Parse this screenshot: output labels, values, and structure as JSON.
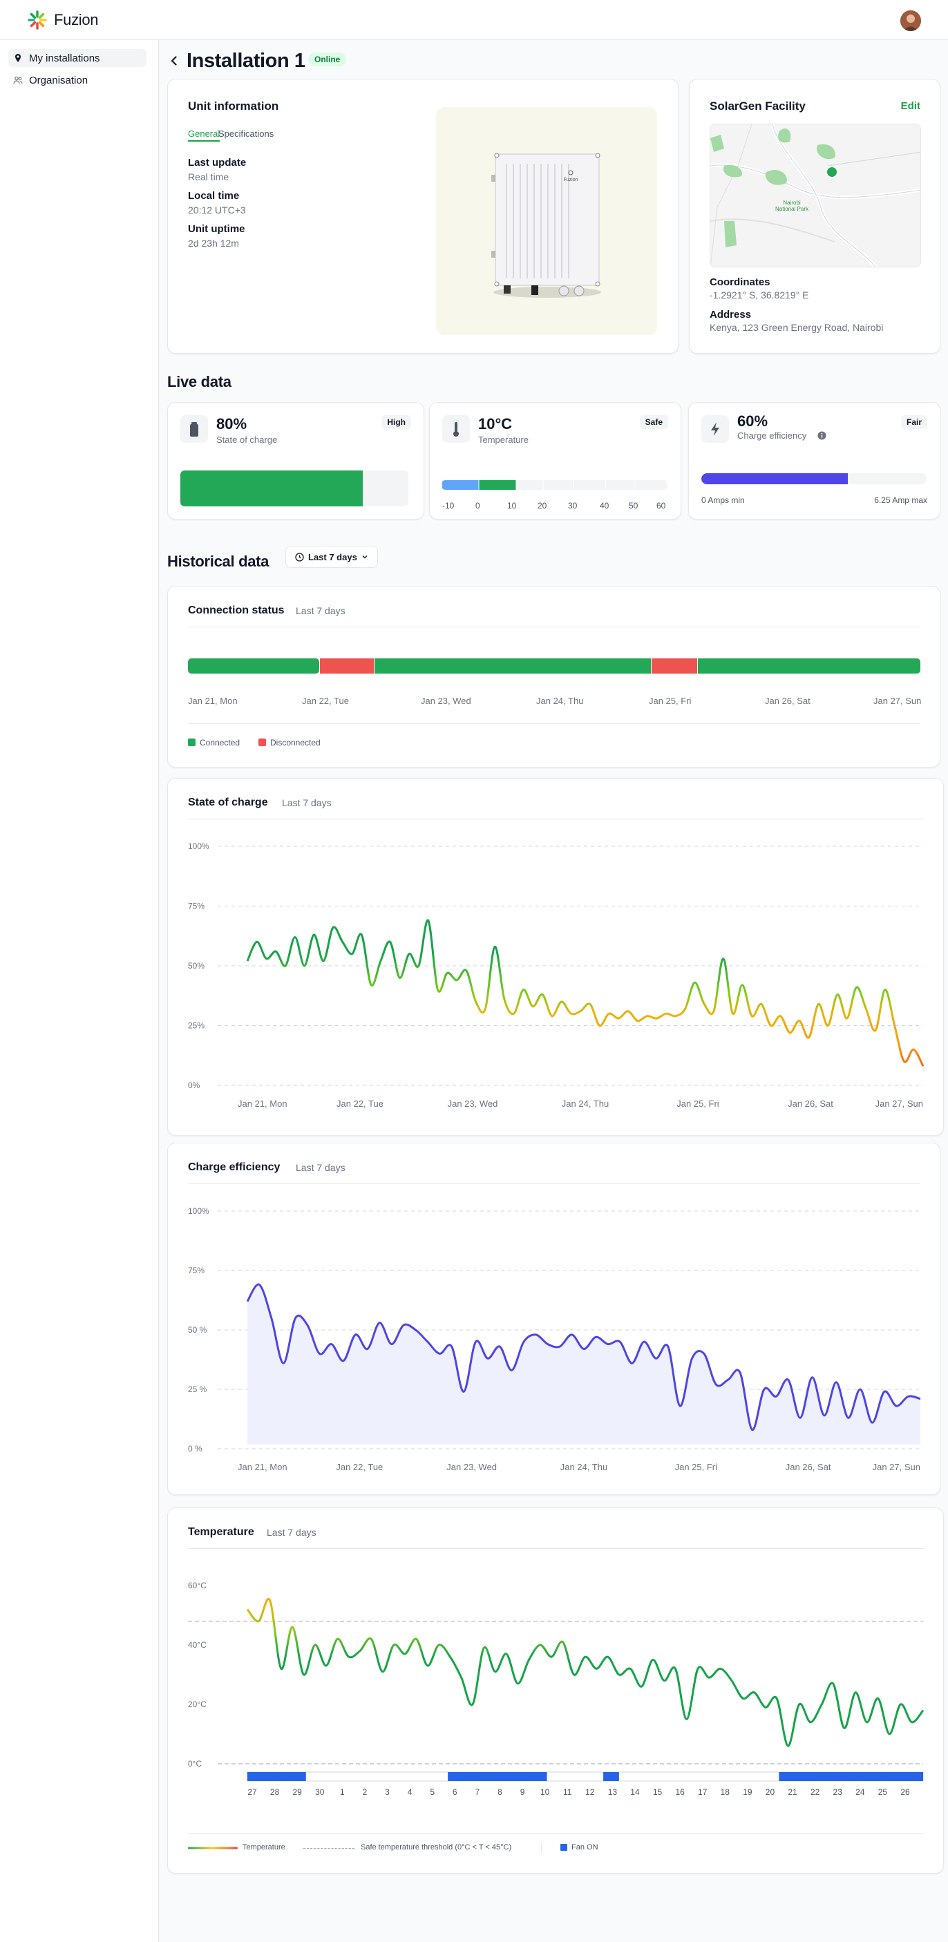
{
  "app": {
    "name": "Fuzion"
  },
  "sidebar": {
    "items": [
      {
        "label": "My installations"
      },
      {
        "label": "Organisation"
      }
    ]
  },
  "page": {
    "title": "Installation 1",
    "status": "Online"
  },
  "unit_info": {
    "title": "Unit information",
    "tabs": [
      {
        "label": "General"
      },
      {
        "label": "Specifications"
      }
    ],
    "fields": [
      {
        "label": "Last update",
        "value": "Real time"
      },
      {
        "label": "Local time",
        "value": "20:12 UTC+3"
      },
      {
        "label": "Unit uptime",
        "value": "2d 23h 12m"
      }
    ],
    "device_brand": "Fuzion"
  },
  "facility": {
    "title": "SolarGen Facility",
    "edit_label": "Edit",
    "map_label_line1": "Nairobi",
    "map_label_line2": "National Park",
    "coordinates_label": "Coordinates",
    "coordinates": "-1.2921° S, 36.8219° E",
    "address_label": "Address",
    "address": "Kenya, 123 Green Energy Road, Nairobi"
  },
  "live": {
    "title": "Live data",
    "soc": {
      "value": "80%",
      "label": "State of charge",
      "badge": "High",
      "fill": 0.8
    },
    "temp": {
      "value": "10°C",
      "label": "Temperature",
      "badge": "Safe",
      "ticks": [
        "-10",
        "0",
        "10",
        "20",
        "30",
        "40",
        "50",
        "60"
      ]
    },
    "eff": {
      "value": "60%",
      "label": "Charge efficiency",
      "badge": "Fair",
      "fill": 0.65,
      "min_label": "0 Amps min",
      "max_label": "6.25 Amp max"
    }
  },
  "historical": {
    "title": "Historical data",
    "range_label": "Last 7 days"
  },
  "connection": {
    "title": "Connection status",
    "subtitle": "Last 7 days",
    "days": [
      "Jan 21, Mon",
      "Jan 22, Tue",
      "Jan 23, Wed",
      "Jan 24, Thu",
      "Jan 25, Fri",
      "Jan 26, Sat",
      "Jan 27, Sun"
    ],
    "legend": [
      {
        "label": "Connected",
        "color": "#22a857"
      },
      {
        "label": "Disconnected",
        "color": "#ef5350"
      }
    ]
  },
  "colors": {
    "green": "#22a857",
    "red": "#ef5350",
    "purple": "#4f46e5",
    "blue": "#2563eb"
  },
  "chart_data": [
    {
      "type": "line",
      "title": "State of charge",
      "subtitle": "Last 7 days",
      "ylim": [
        0,
        100
      ],
      "yticks": [
        "100%",
        "75%",
        "50%",
        "25%",
        "0%"
      ],
      "categories": [
        "Jan 21, Mon",
        "Jan 22, Tue",
        "Jan 23, Wed",
        "Jan 24, Thu",
        "Jan 25, Fri",
        "Jan 26, Sat",
        "Jan 27, Sun"
      ],
      "values": [
        52,
        60,
        53,
        56,
        50,
        62,
        50,
        63,
        52,
        66,
        60,
        55,
        63,
        42,
        52,
        60,
        45,
        55,
        50,
        69,
        40,
        47,
        44,
        48,
        35,
        32,
        58,
        36,
        30,
        40,
        33,
        38,
        29,
        35,
        30,
        31,
        34,
        25,
        30,
        28,
        31,
        27,
        29,
        28,
        30,
        29,
        32,
        43,
        34,
        31,
        53,
        30,
        42,
        29,
        34,
        25,
        29,
        22,
        27,
        20,
        34,
        25,
        38,
        28,
        41,
        32,
        23,
        40,
        25,
        10,
        15,
        8
      ],
      "grid": true
    },
    {
      "type": "area",
      "title": "Charge efficiency",
      "subtitle": "Last 7 days",
      "ylim": [
        0,
        100
      ],
      "yticks": [
        "100%",
        "75%",
        "50 %",
        "25 %",
        "0 %"
      ],
      "categories": [
        "Jan 21, Mon",
        "Jan 22, Tue",
        "Jan 23, Wed",
        "Jan 24, Thu",
        "Jan 25, Fri",
        "Jan 26, Sat",
        "Jan 27, Sun"
      ],
      "values": [
        62,
        69,
        55,
        36,
        55,
        52,
        40,
        44,
        37,
        48,
        42,
        53,
        44,
        52,
        50,
        45,
        40,
        43,
        24,
        45,
        38,
        43,
        33,
        45,
        48,
        44,
        43,
        48,
        42,
        47,
        44,
        45,
        36,
        45,
        38,
        43,
        18,
        38,
        40,
        27,
        29,
        32,
        8,
        25,
        22,
        29,
        13,
        30,
        14,
        28,
        13,
        25,
        11,
        24,
        18,
        22,
        21
      ],
      "grid": true
    },
    {
      "type": "line",
      "title": "Temperature",
      "subtitle": "Last 7 days",
      "ylim": [
        0,
        60
      ],
      "yticks": [
        "60°C",
        "40°C",
        "20°C",
        "0°C"
      ],
      "threshold": 48,
      "categories": [
        "27",
        "28",
        "29",
        "30",
        "1",
        "2",
        "3",
        "4",
        "5",
        "6",
        "7",
        "8",
        "9",
        "10",
        "11",
        "12",
        "13",
        "14",
        "15",
        "16",
        "17",
        "18",
        "19",
        "20",
        "21",
        "22",
        "23",
        "24",
        "25",
        "26"
      ],
      "values": [
        52,
        48,
        55,
        32,
        46,
        30,
        40,
        33,
        42,
        36,
        38,
        42,
        31,
        40,
        37,
        42,
        33,
        40,
        36,
        29,
        20,
        39,
        31,
        37,
        27,
        35,
        40,
        36,
        41,
        30,
        36,
        32,
        36,
        30,
        32,
        26,
        35,
        28,
        32,
        15,
        32,
        29,
        32,
        28,
        22,
        24,
        19,
        22,
        6,
        20,
        14,
        20,
        27,
        12,
        24,
        14,
        22,
        10,
        20,
        14,
        18
      ],
      "fan_on": [
        [
          0,
          2.6
        ],
        [
          8.9,
          13.3
        ],
        [
          15.8,
          16.5
        ],
        [
          23.6,
          30
        ]
      ],
      "legend": [
        {
          "label": "Temperature"
        },
        {
          "label": "Safe temperature threshold (0°C < T < 45°C)"
        },
        {
          "label": "Fan ON"
        }
      ]
    }
  ]
}
